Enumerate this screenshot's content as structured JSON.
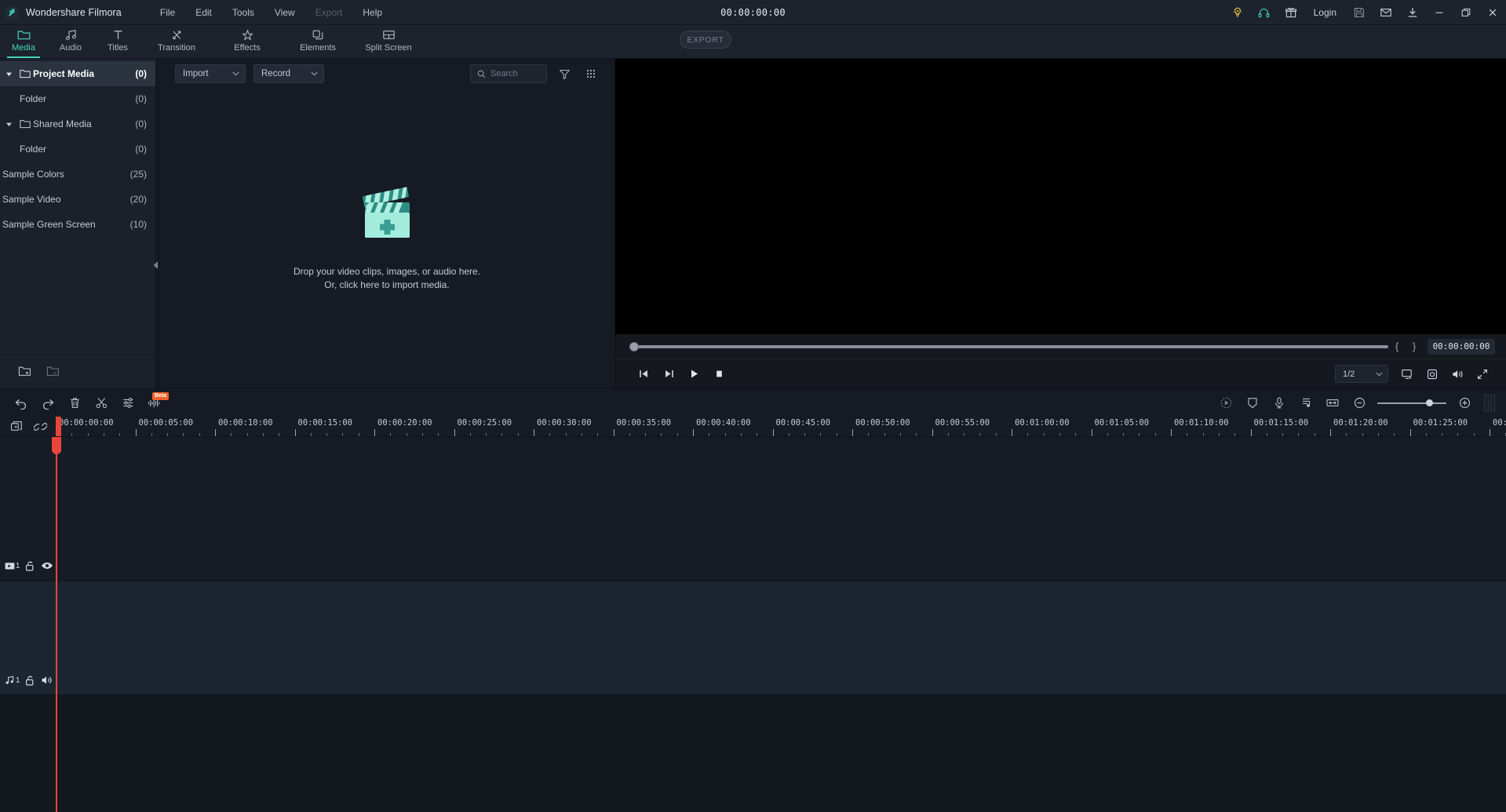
{
  "titlebar": {
    "app_title": "Wondershare Filmora",
    "logo_icon": "filmora-logo-icon",
    "menu": [
      {
        "label": "File",
        "disabled": false
      },
      {
        "label": "Edit",
        "disabled": false
      },
      {
        "label": "Tools",
        "disabled": false
      },
      {
        "label": "View",
        "disabled": false
      },
      {
        "label": "Export",
        "disabled": true
      },
      {
        "label": "Help",
        "disabled": false
      }
    ],
    "timecode": "00:00:00:00",
    "login_label": "Login",
    "icons": {
      "tips": "lightbulb-icon",
      "support": "headset-icon",
      "gift": "gift-icon",
      "save": "save-icon",
      "mail": "mail-icon",
      "download": "download-icon",
      "minimize": "minimize-icon",
      "maximize": "maximize-icon",
      "close": "close-icon"
    },
    "accent_color": "#45d4bd",
    "tips_color": "#e8c547"
  },
  "tabbar": {
    "tabs": [
      {
        "label": "Media",
        "icon": "folder-icon",
        "active": true
      },
      {
        "label": "Audio",
        "icon": "music-note-icon",
        "active": false
      },
      {
        "label": "Titles",
        "icon": "text-t-icon",
        "active": false
      },
      {
        "label": "Transition",
        "icon": "transition-arrows-icon",
        "active": false
      },
      {
        "label": "Effects",
        "icon": "sparkle-star-icon",
        "active": false
      },
      {
        "label": "Elements",
        "icon": "layers-icon",
        "active": false
      },
      {
        "label": "Split Screen",
        "icon": "split-screen-icon",
        "active": false
      }
    ],
    "export_label": "EXPORT"
  },
  "sidebar": {
    "items": [
      {
        "label": "Project Media",
        "count": "(0)",
        "type": "folder",
        "expanded": true,
        "selected": true,
        "indent": 0
      },
      {
        "label": "Folder",
        "count": "(0)",
        "type": "child",
        "expanded": false,
        "selected": false,
        "indent": 1
      },
      {
        "label": "Shared Media",
        "count": "(0)",
        "type": "folder",
        "expanded": true,
        "selected": false,
        "indent": 0
      },
      {
        "label": "Folder",
        "count": "(0)",
        "type": "child",
        "expanded": false,
        "selected": false,
        "indent": 1
      },
      {
        "label": "Sample Colors",
        "count": "(25)",
        "type": "flat",
        "expanded": false,
        "selected": false,
        "indent": 0
      },
      {
        "label": "Sample Video",
        "count": "(20)",
        "type": "flat",
        "expanded": false,
        "selected": false,
        "indent": 0
      },
      {
        "label": "Sample Green Screen",
        "count": "(10)",
        "type": "flat",
        "expanded": false,
        "selected": false,
        "indent": 0
      }
    ],
    "footer": {
      "add_folder": "add-folder-icon",
      "remove_folder": "remove-folder-icon"
    },
    "collapse_handle": "collapse-panel-icon"
  },
  "media_panel": {
    "import_label": "Import",
    "record_label": "Record",
    "search_placeholder": "Search",
    "filter_icon": "filter-funnel-icon",
    "grid_icon": "grid-view-icon",
    "drop_line_1": "Drop your video clips, images, or audio here.",
    "drop_line_2": "Or, click here to import media.",
    "clapper_icon": "clapperboard-plus-icon"
  },
  "preview": {
    "current_time": "00:00:00:00",
    "mark_in": "{",
    "mark_out": "}",
    "ratio_label": "1/2",
    "controls": {
      "prev_frame": "previous-frame-icon",
      "next_frame": "next-frame-icon",
      "play": "play-icon",
      "stop": "stop-icon",
      "display": "display-mode-icon",
      "snapshot": "snapshot-camera-icon",
      "volume": "volume-icon",
      "fullscreen": "fullscreen-icon"
    }
  },
  "timeline": {
    "toolbar_left": [
      {
        "name": "undo-icon",
        "label": "Undo"
      },
      {
        "name": "redo-icon",
        "label": "Redo"
      },
      {
        "name": "delete-trash-icon",
        "label": "Delete"
      },
      {
        "name": "cut-scissors-icon",
        "label": "Split"
      },
      {
        "name": "adjust-sliders-icon",
        "label": "Settings"
      },
      {
        "name": "audio-beat-icon",
        "label": "Beat Detect",
        "badge": "Beta"
      }
    ],
    "toolbar_right": [
      {
        "name": "speed-icon",
        "label": "Speed"
      },
      {
        "name": "crop-mask-icon",
        "label": "Crop"
      },
      {
        "name": "voiceover-mic-icon",
        "label": "Record Voiceover"
      },
      {
        "name": "detach-audio-icon",
        "label": "Detach Audio"
      },
      {
        "name": "fit-timeline-icon",
        "label": "Zoom to Fit"
      },
      {
        "name": "zoom-out-icon",
        "label": "Zoom Out"
      },
      {
        "name": "zoom-in-icon",
        "label": "Zoom In"
      },
      {
        "name": "marker-icon",
        "label": "Marker"
      }
    ],
    "add_track_icon": "add-track-icon",
    "link_icon": "link-clip-icon",
    "ruler_labels": [
      "00:00:00:00",
      "00:00:05:00",
      "00:00:10:00",
      "00:00:15:00",
      "00:00:20:00",
      "00:00:25:00",
      "00:00:30:00",
      "00:00:35:00",
      "00:00:40:00",
      "00:00:45:00",
      "00:00:50:00",
      "00:00:55:00",
      "00:01:00:00",
      "00:01:05:00",
      "00:01:10:00",
      "00:01:15:00",
      "00:01:20:00",
      "00:01:25:00",
      "00:0"
    ],
    "tracks": [
      {
        "kind": "video",
        "number": "1",
        "icon": "video-track-icon",
        "lock": "unlock-icon",
        "toggle": "eye-icon"
      },
      {
        "kind": "audio",
        "number": "1",
        "icon": "audio-track-icon",
        "lock": "unlock-icon",
        "toggle": "speaker-icon"
      }
    ],
    "playhead_color": "#e8453c"
  }
}
